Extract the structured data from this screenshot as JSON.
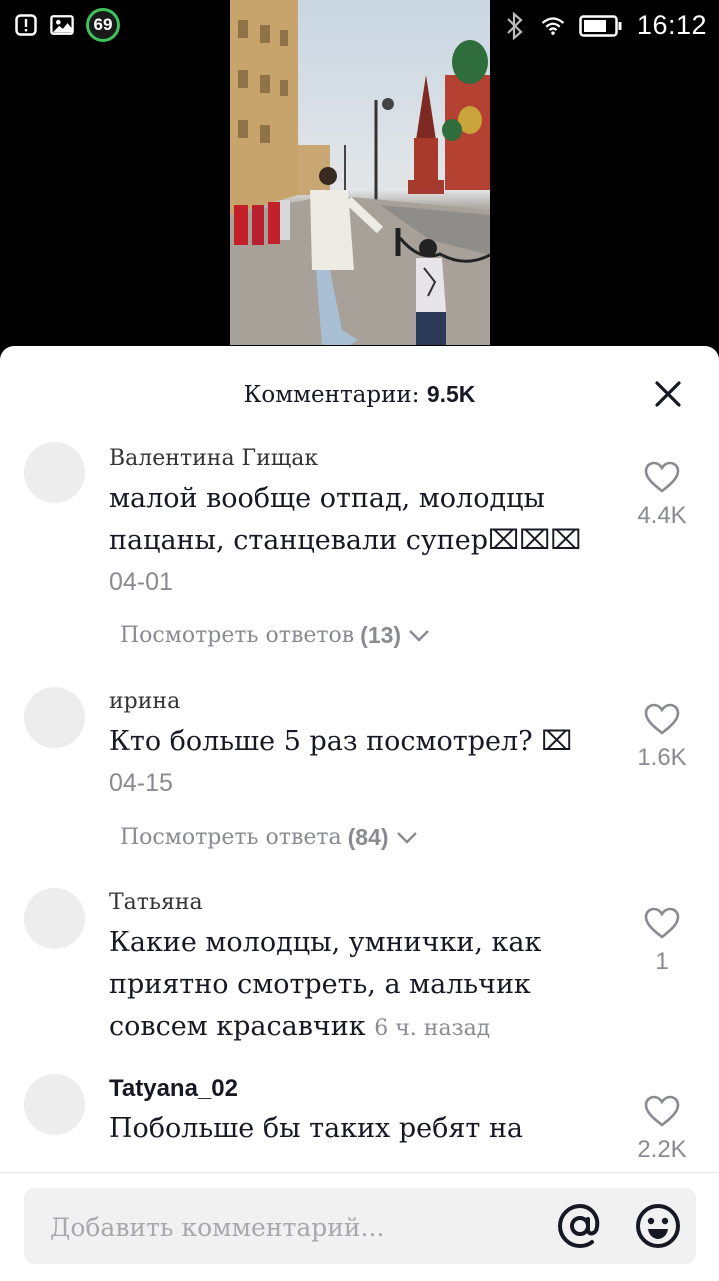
{
  "status_bar": {
    "badge_number": "69",
    "time": "16:12"
  },
  "comments_header": {
    "label": "Комментарии:",
    "count": "9.5K"
  },
  "comments": [
    {
      "author": "Валентина Гищак",
      "text": "малой вообще отпад, молодцы пацаны, станцевали супер⌧⌧⌧",
      "date": "04-01",
      "likes": "4.4K",
      "replies_label": "Посмотреть ответов",
      "replies_count": "(13)"
    },
    {
      "author": "ирина",
      "text": "Кто больше 5 раз посмотрел? ⌧",
      "date": "04-15",
      "likes": "1.6K",
      "replies_label": "Посмотреть ответа",
      "replies_count": "(84)"
    },
    {
      "author": "Татьяна",
      "text": "Какие молодцы, умнички, как приятно смотреть, а мальчик совсем красавчик",
      "date": "6 ч. назад",
      "likes": "1"
    },
    {
      "author": "Tatyana_02",
      "text": "Побольше бы таких ребят на",
      "likes": "2.2K"
    }
  ],
  "input": {
    "placeholder": "Добавить комментарий..."
  },
  "icons": {
    "close": "close-icon",
    "like": "heart-icon",
    "mention": "at-icon",
    "emoji": "emoji-icon"
  }
}
